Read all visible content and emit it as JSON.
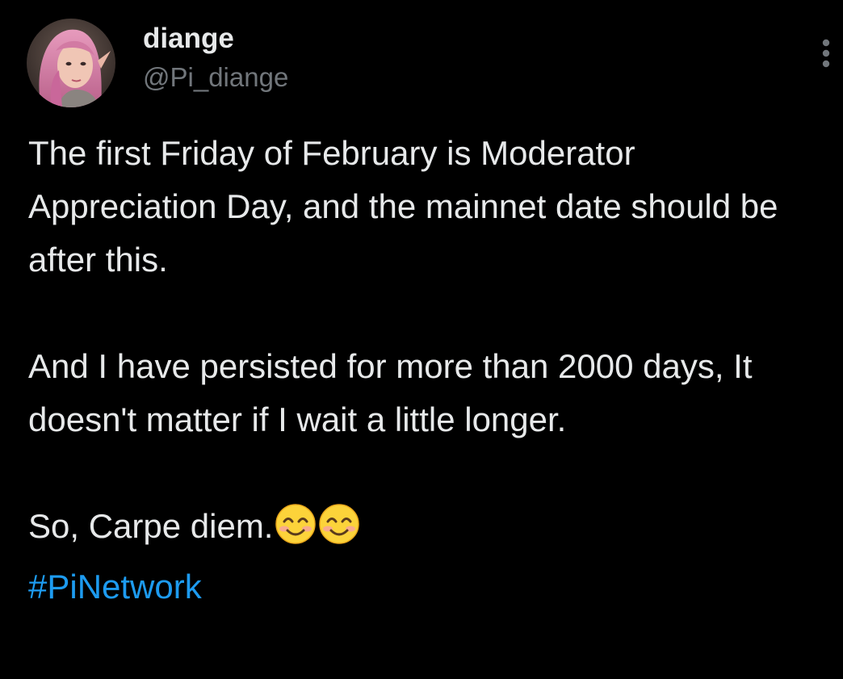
{
  "author": {
    "display_name": "diange",
    "handle": "@Pi_diange",
    "avatar_icon": "elf-portrait-avatar"
  },
  "tweet": {
    "paragraph_1": "The first Friday of February is Moderator Appreciation Day, and the mainnet date should be after this.",
    "paragraph_2": "And I have persisted for more than 2000 days,  It doesn't matter if I wait a little longer.",
    "paragraph_3": "So, Carpe diem.",
    "emojis": [
      "smiling-face-with-smiling-eyes",
      "smiling-face-with-smiling-eyes"
    ],
    "hashtag": "#PiNetwork"
  },
  "colors": {
    "background": "#000000",
    "text": "#e7e9ea",
    "secondary_text": "#71767b",
    "link": "#1d9bf0"
  },
  "icons": {
    "more": "more-vertical-icon"
  }
}
